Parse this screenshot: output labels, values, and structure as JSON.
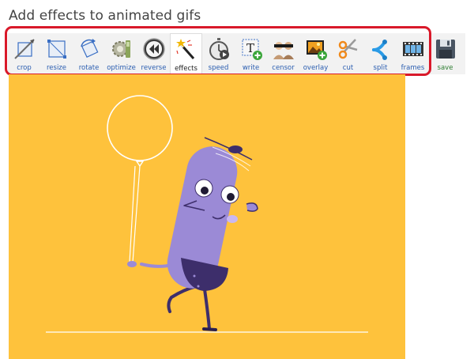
{
  "page": {
    "title": "Add effects to animated gifs"
  },
  "toolbar": {
    "items": [
      {
        "label": "crop",
        "icon": "crop-icon"
      },
      {
        "label": "resize",
        "icon": "resize-icon"
      },
      {
        "label": "rotate",
        "icon": "rotate-icon"
      },
      {
        "label": "optimize",
        "icon": "optimize-icon"
      },
      {
        "label": "reverse",
        "icon": "reverse-icon"
      },
      {
        "label": "effects",
        "icon": "magic-wand-icon",
        "active": true
      },
      {
        "label": "speed",
        "icon": "stopwatch-icon"
      },
      {
        "label": "write",
        "icon": "text-icon"
      },
      {
        "label": "censor",
        "icon": "censor-icon"
      },
      {
        "label": "overlay",
        "icon": "overlay-icon"
      },
      {
        "label": "cut",
        "icon": "scissors-icon"
      },
      {
        "label": "split",
        "icon": "split-icon"
      },
      {
        "label": "frames",
        "icon": "film-icon"
      },
      {
        "label": "save",
        "icon": "floppy-disk-icon"
      }
    ],
    "highlight_color": "#d9192a",
    "label_color": "#2a5db0",
    "save_label_color": "#2e7d32"
  },
  "canvas": {
    "background": "#fec23c",
    "character_color": "#9b8ad6",
    "pants_color": "#3d2e6b"
  }
}
